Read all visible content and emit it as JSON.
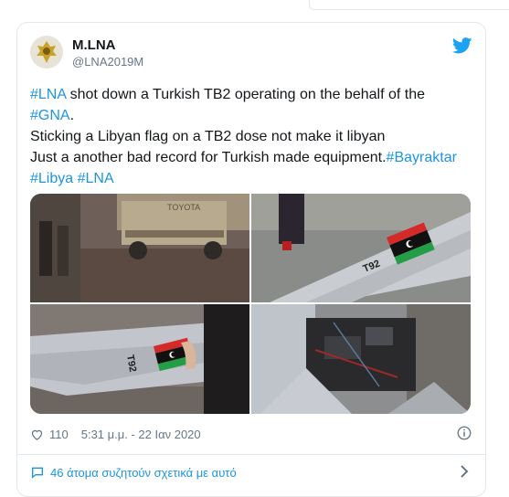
{
  "tweet": {
    "author_name": "M.LNA",
    "author_handle": "@LNA2019M",
    "line1_tag": "#LNA",
    "line1_text": " shot down a Turkish TB2 operating on the behalf of the",
    "line2_tag": "#GNA",
    "line2_text": ".",
    "line3_text": "Sticking a Libyan flag on a TB2 dose not make it libyan",
    "line4_text": "Just a another bad record for Turkish made equipment.",
    "line4_tag": "#Bayraktar",
    "line5_tag1": "#Libya",
    "line5_tag2": "#LNA",
    "likes": "110",
    "timestamp": "5:31 μ.μ. - 22 Ιαν 2020",
    "discussion": "46 άτομα συζητούν σχετικά με αυτό",
    "photo_texts": {
      "truck_brand": "TOYOTA",
      "drone_mark_1": "T92",
      "drone_mark_2": "T92"
    }
  },
  "colors": {
    "link": "#1b95e0",
    "text": "#14171a",
    "muted": "#657786",
    "border": "#e1e8ed"
  },
  "icons": [
    "twitter-bird-icon",
    "heart-icon",
    "info-icon",
    "chat-icon",
    "chevron-right-icon"
  ]
}
